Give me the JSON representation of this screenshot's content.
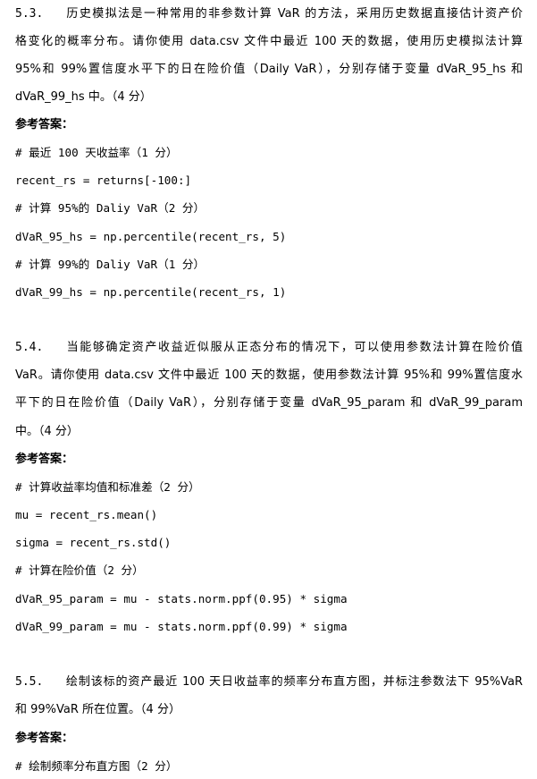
{
  "q53": {
    "number": "5.3.",
    "lines": [
      "历史模拟法是一种常用的非参数计算 VaR 的方法，采用历史数据直接估计资产价",
      "格变化的概率分布。请你使用 data.csv 文件中最近 100 天的数据，使用历史模拟法计算",
      "95%和 99%置信度水平下的日在险价值（Daily  VaR），分别存储于变量 dVaR_95_hs 和",
      "dVaR_99_hs 中。（4 分）"
    ],
    "answer_label": "参考答案：",
    "code": [
      "# 最近 100 天收益率（1 分）",
      "recent_rs = returns[-100:]",
      "# 计算 95%的 Daliy VaR（2 分）",
      "dVaR_95_hs = np.percentile(recent_rs, 5)",
      "# 计算 99%的 Daliy VaR（1 分）",
      "dVaR_99_hs = np.percentile(recent_rs, 1)"
    ]
  },
  "q54": {
    "number": "5.4.",
    "lines": [
      "当能够确定资产收益近似服从正态分布的情况下，可以使用参数法计算在险价值",
      "VaR。请你使用 data.csv 文件中最近 100 天的数据，使用参数法计算 95%和 99%置信度水",
      "平下的日在险价值（Daily  VaR），分别存储于变量 dVaR_95_param 和 dVaR_99_param",
      "中。（4 分）"
    ],
    "answer_label": "参考答案：",
    "code": [
      "# 计算收益率均值和标准差（2 分）",
      "mu = recent_rs.mean()",
      "sigma = recent_rs.std()",
      "# 计算在险价值（2 分）",
      "dVaR_95_param = mu - stats.norm.ppf(0.95) * sigma",
      "dVaR_99_param = mu - stats.norm.ppf(0.99) * sigma"
    ]
  },
  "q55": {
    "number": "5.5.",
    "lines": [
      "绘制该标的资产最近 100 天日收益率的频率分布直方图，并标注参数法下 95%VaR",
      "和 99%VaR 所在位置。（4 分）"
    ],
    "answer_label": "参考答案：",
    "code": [
      "# 绘制频率分布直方图（2 分）"
    ]
  }
}
